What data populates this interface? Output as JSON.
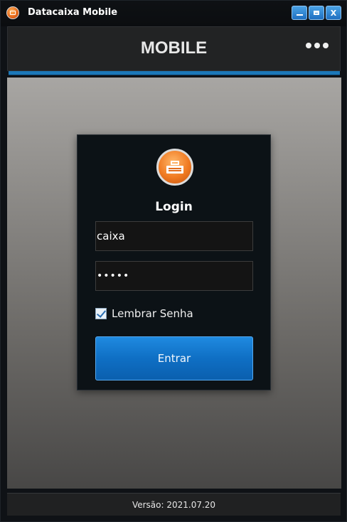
{
  "window": {
    "title": "Datacaixa Mobile",
    "icons": {
      "app": "cash-register-icon",
      "minimize": "minimize-icon",
      "maximize": "maximize-icon",
      "close": "close-icon"
    },
    "close_glyph": "X"
  },
  "header": {
    "title": "MOBILE",
    "menu_icon": "more-dots-icon"
  },
  "login": {
    "title": "Login",
    "username_value": "caixa",
    "password_value": "•••••",
    "remember_label": "Lembrar Senha",
    "remember_checked": true,
    "submit_label": "Entrar"
  },
  "footer": {
    "version": "Versão: 2021.07.20"
  },
  "colors": {
    "accent": "#1c78b8",
    "button": "#0f6fc4",
    "logo": "#f07a22"
  }
}
